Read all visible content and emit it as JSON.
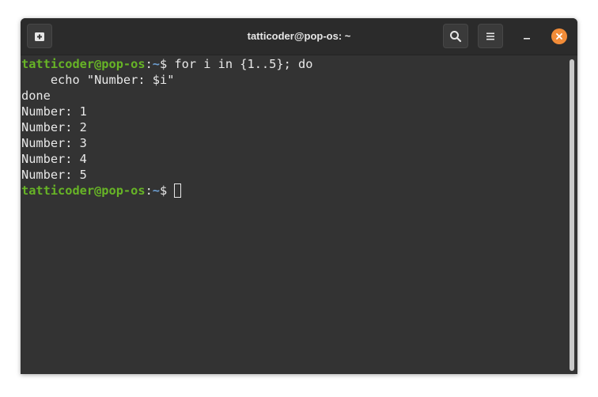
{
  "window": {
    "title": "tatticoder@pop-os: ~"
  },
  "icons": {
    "new_tab": "new-tab-icon",
    "search": "search-icon",
    "menu": "hamburger-menu-icon",
    "minimize": "minimize-icon",
    "close": "close-icon"
  },
  "colors": {
    "prompt_user": "#67b426",
    "prompt_path": "#6d9ed0",
    "close_button": "#f28c38",
    "background": "#333333"
  },
  "terminal": {
    "prompt_user": "tatticoder@pop-os",
    "prompt_sep": ":",
    "prompt_path": "~",
    "prompt_symbol": "$ ",
    "command": "for i in {1..5}; do",
    "command_line2": "    echo \"Number: $i\"",
    "command_line3": "done",
    "output": [
      "Number: 1",
      "Number: 2",
      "Number: 3",
      "Number: 4",
      "Number: 5"
    ]
  }
}
